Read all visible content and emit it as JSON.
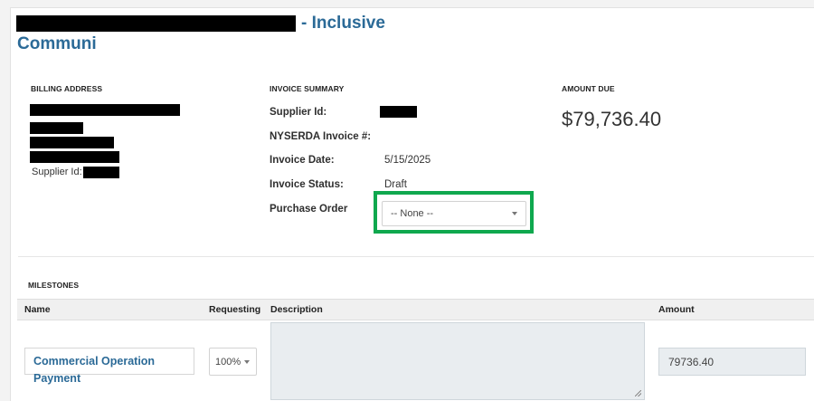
{
  "header": {
    "title_suffix": "- Inclusive",
    "title_line2": "Communi"
  },
  "billing": {
    "section_label": "BILLING ADDRESS",
    "supplier_id_label": "Supplier Id:"
  },
  "invoice_summary": {
    "section_label": "INVOICE SUMMARY",
    "supplier_id_label": "Supplier Id:",
    "nyserda_invoice_label": "NYSERDA Invoice #:",
    "nyserda_invoice_value": "",
    "invoice_date_label": "Invoice Date:",
    "invoice_date_value": "5/15/2025",
    "invoice_status_label": "Invoice Status:",
    "invoice_status_value": "Draft",
    "purchase_order_label": "Purchase Order",
    "purchase_order_selected": "-- None --"
  },
  "amount_due": {
    "section_label": "AMOUNT DUE",
    "value": "$79,736.40"
  },
  "milestones": {
    "section_label": "MILESTONES",
    "columns": [
      "Name",
      "Requesting",
      "Description",
      "Amount"
    ],
    "rows": [
      {
        "name": "Commercial Operation Payment",
        "requesting": "100%",
        "description": "",
        "amount": "79736.40"
      }
    ]
  },
  "highlight_color": "#0fa84e",
  "accent_color": "#2b6a97"
}
